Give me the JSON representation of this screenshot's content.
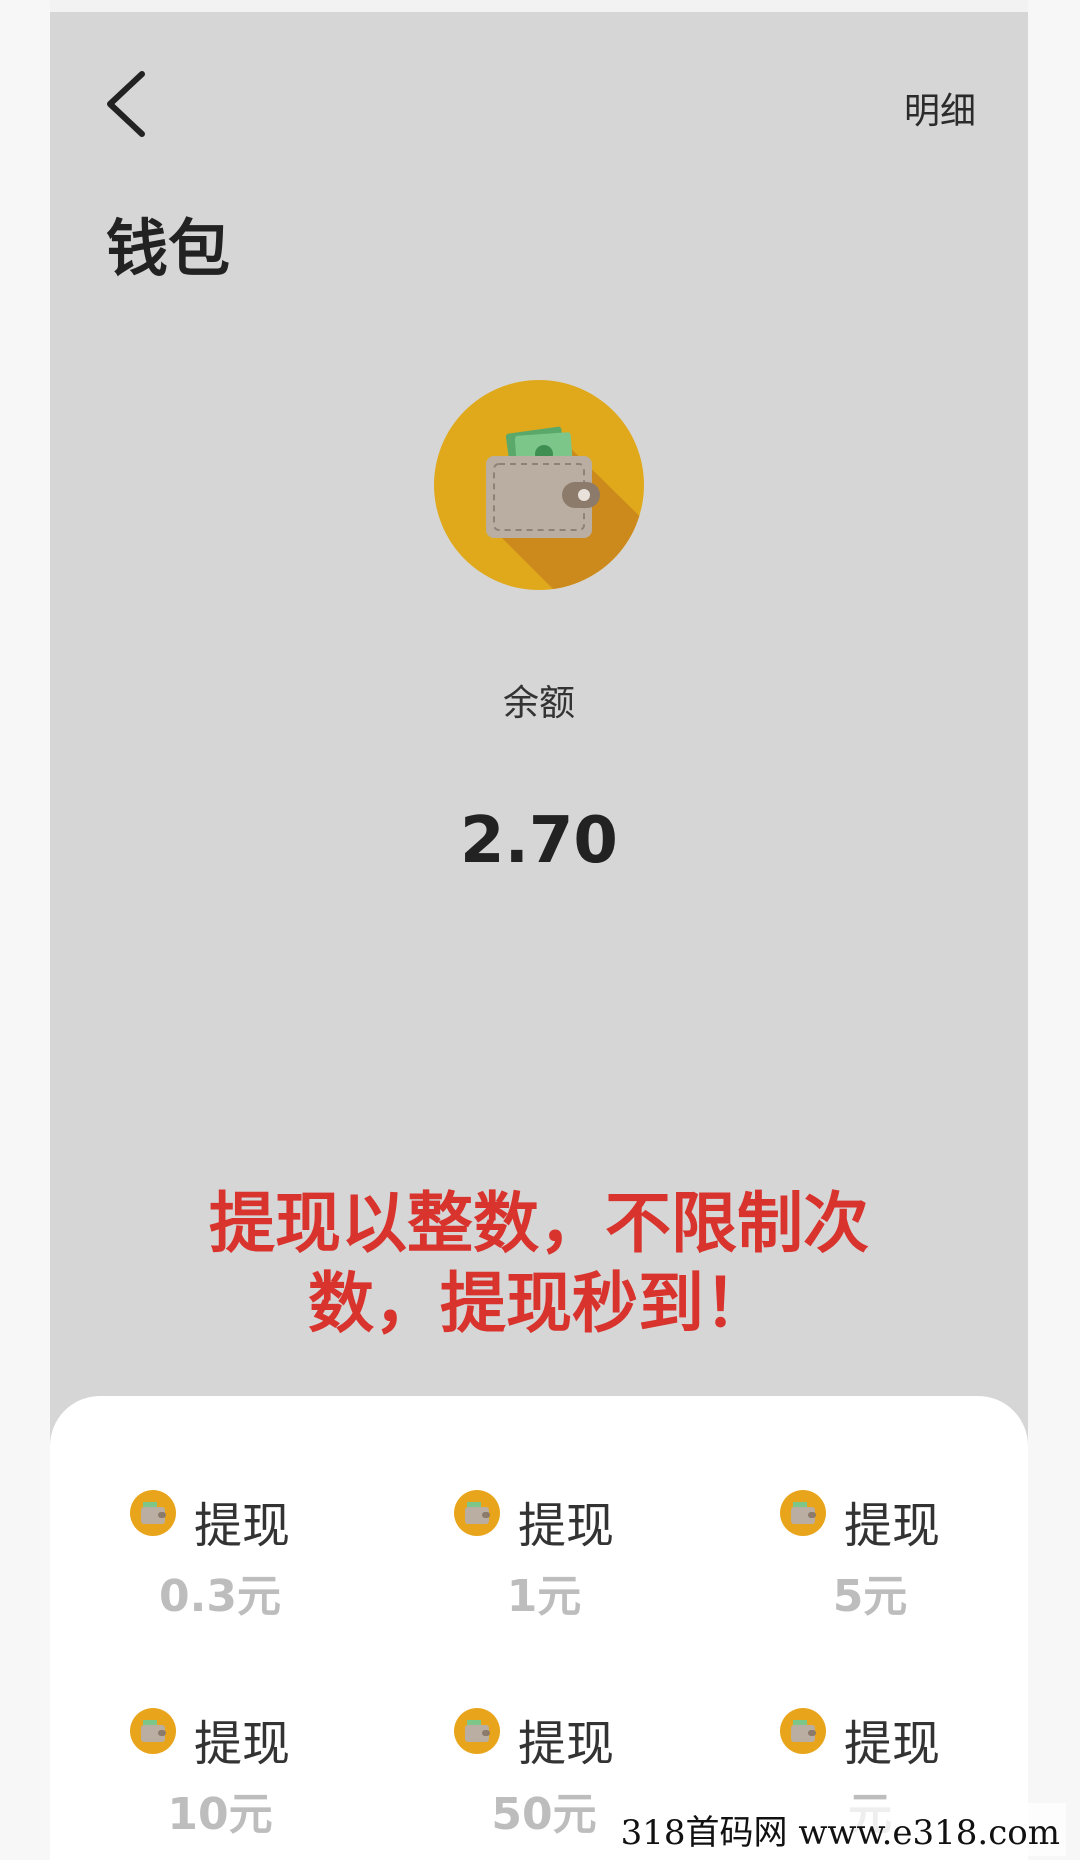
{
  "header": {
    "detail_label": "明细",
    "title": "钱包"
  },
  "balance": {
    "label": "余额",
    "value": "2.70"
  },
  "promo": {
    "line1": "提现以整数，不限制次",
    "line2": "数，提现秒到！"
  },
  "withdraw_options": [
    {
      "label": "提现",
      "amount": "0.3元"
    },
    {
      "label": "提现",
      "amount": "1元"
    },
    {
      "label": "提现",
      "amount": "5元"
    },
    {
      "label": "提现",
      "amount": "10元"
    },
    {
      "label": "提现",
      "amount": "50元"
    },
    {
      "label": "提现",
      "amount": "元"
    }
  ],
  "watermark": "318首码网  www.e318.com",
  "colors": {
    "background": "#d6d6d6",
    "sheet": "#ffffff",
    "promo_text": "#d8332d",
    "wallet_circle": "#e0a91b",
    "amount_text": "#bdbdbd"
  }
}
